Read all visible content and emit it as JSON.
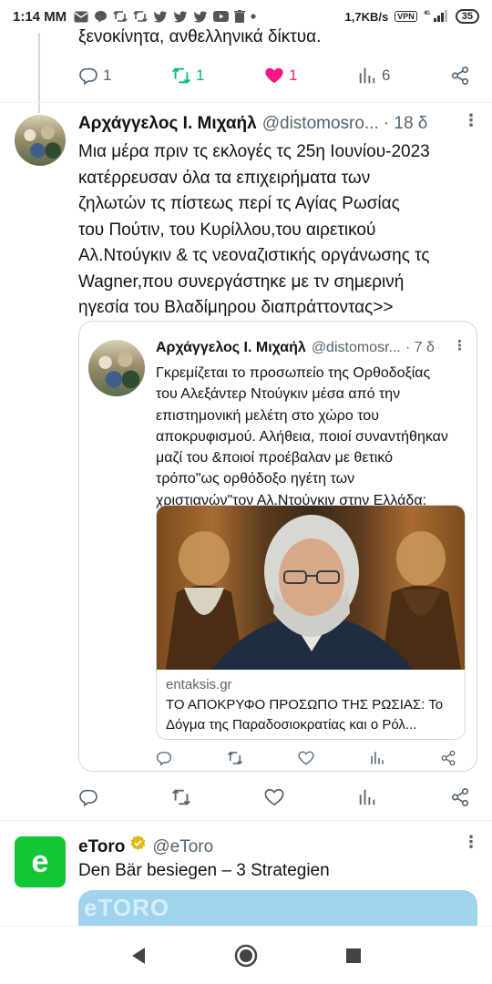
{
  "status_bar": {
    "time": "1:14 MM",
    "notification_icons": [
      "mail-icon",
      "chat-icon",
      "retweet-icon",
      "retweet-icon",
      "twitter-icon",
      "twitter-icon",
      "twitter-icon",
      "youtube-icon",
      "trash-icon",
      "dot-icon"
    ],
    "net_speed": "1,7KB/s",
    "vpn_label": "VPN",
    "network": "4G",
    "battery": "35"
  },
  "previous_tweet": {
    "text_fragment": "ξενοκίνητα, ανθελληνικά δίκτυα.",
    "actions": {
      "replies": "1",
      "retweets": "1",
      "likes": "1",
      "views": "6"
    }
  },
  "tweet": {
    "name": "Αρχάγγελος Ι. Μιχαήλ",
    "handle": "@distomosro...",
    "time": "· 18 δ",
    "text_lines": [
      "Μια μέρα πριν τς εκλογές τς 25η Ιουνίου-2023",
      "κατέρρευσαν όλα τα επιχειρήματα των",
      "ζηλωτών τς πίστεως περί τς Αγίας Ρωσίας",
      "του Πούτιν, του Κυρίλλου,του αιρετικού",
      "Αλ.Ντούγκιν & τς νεοναζιστικής οργάνωσης τς",
      "Wagner,που συνεργάστηκε με τν σημερινή",
      "ηγεσία του Βλαδίμηρου διαπράττοντας>>"
    ],
    "quote": {
      "name": "Αρχάγγελος Ι. Μιχαήλ",
      "handle": "@distomosr...",
      "time": "· 7 δ",
      "text_lines": [
        "Γκρεμίζεται το προσωπείο της Ορθοδοξίας",
        "του Αλεξάντερ Ντούγκιν μέσα από την",
        "επιστημονική μελέτη στο χώρο του",
        "αποκρυφισμού. Αλήθεια, ποιοί συναντήθηκαν",
        "μαζί του &ποιοί  προέβαλαν με θετικό",
        "τρόπο\"ως ορθόδοξο ηγέτη των",
        "χριστιανών\"τον Αλ.Ντούγκιν στην Ελλάδα;"
      ],
      "link": {
        "domain": "entaksis.gr",
        "title_lines": [
          "ΤΟ ΑΠΟΚΡΥΦΟ ΠΡΟΣΩΠΟ ΤΗΣ ΡΩΣΙΑΣ: Το",
          "Δόγμα της Παραδοσιοκρατίας και ο Ρόλ..."
        ]
      }
    }
  },
  "ad_tweet": {
    "name": "eToro",
    "handle": "@eToro",
    "text": "Den Bär besiegen – 3 Strategien",
    "logo_letter": "e",
    "card_logo": "eTORO"
  },
  "colors": {
    "text": "#0f1419",
    "secondary": "#536471",
    "retweet_green": "#00ba7c",
    "like_pink": "#f91880",
    "etoro_green": "#13c636"
  }
}
